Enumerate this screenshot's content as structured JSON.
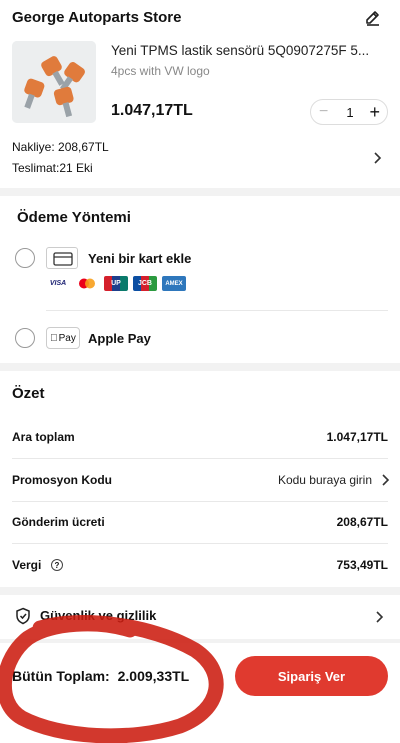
{
  "store": {
    "name": "George Autoparts Store",
    "product_name": "Yeni TPMS lastik sensörü 5Q0907275F 5...",
    "variant": "4pcs with VW logo",
    "price": "1.047,17TL",
    "quantity": "1",
    "shipping": "Nakliye: 208,67TL",
    "delivery": "Teslimat:21 Eki"
  },
  "payment": {
    "title": "Ödeme Yöntemi",
    "add_card_label": "Yeni bir kart ekle",
    "card_brands": [
      "VISA",
      "MC",
      "UP",
      "JCB",
      "AMEX"
    ],
    "apple_pay_icon_text": "Pay",
    "apple_pay_label": "Apple Pay"
  },
  "summary": {
    "title": "Özet",
    "rows": [
      {
        "label": "Ara toplam",
        "value": "1.047,17TL"
      },
      {
        "label": "Promosyon Kodu",
        "value": "Kodu buraya girin"
      },
      {
        "label": "Gönderim ücreti",
        "value": "208,67TL"
      },
      {
        "label": "Vergi",
        "value": "753,49TL"
      }
    ]
  },
  "security": {
    "label": "Güvenlik ve gizlilik"
  },
  "footer": {
    "total_label": "Bütün Toplam:",
    "total_value": "2.009,33TL",
    "order_button": "Sipariş Ver"
  },
  "colors": {
    "accent": "#e03a2f",
    "annotation": "#cc1c10"
  }
}
